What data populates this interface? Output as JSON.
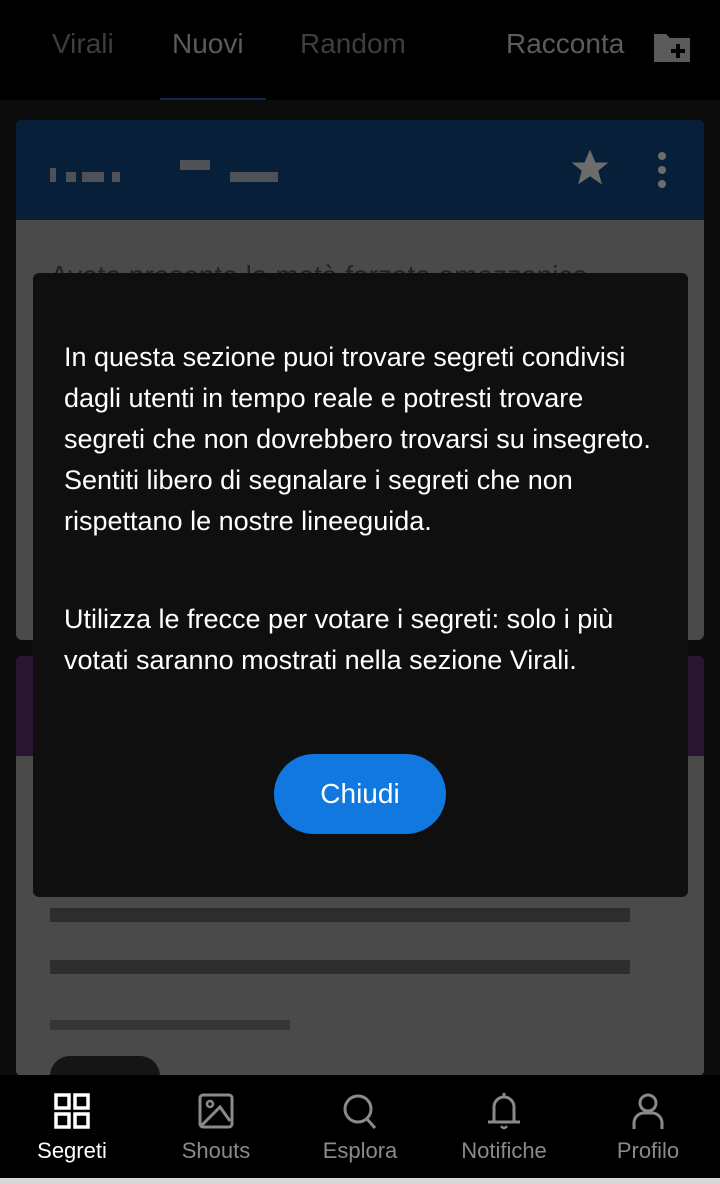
{
  "top_tabs": [
    {
      "label": "Virali",
      "active": false
    },
    {
      "label": "Nuovi",
      "active": true
    },
    {
      "label": "Random",
      "active": false
    }
  ],
  "racconta_label": "Racconta",
  "racconta_icon": "folder-plus-icon",
  "card1": {
    "header_color": "#071f38",
    "icons": [
      "star-icon",
      "more-vert-icon"
    ],
    "text_partial": "Avete presente la metà forzata amazzonica"
  },
  "card2": {
    "header_color": "#2a1530"
  },
  "modal": {
    "paragraph1": "In questa sezione puoi trovare segreti condivisi dagli utenti in tempo reale e potresti trovare segreti che non dovrebbero trovarsi su insegreto. Sentiti libero di segnalare i segreti che non rispettano le nostre lineeguida.",
    "paragraph2": "Utilizza le frecce per votare i segreti: solo i più votati saranno mostrati nella sezione Virali.",
    "close_label": "Chiudi",
    "button_color": "#1178e0"
  },
  "bottom_nav": [
    {
      "label": "Segreti",
      "icon": "grid-icon",
      "active": true
    },
    {
      "label": "Shouts",
      "icon": "image-icon",
      "active": false
    },
    {
      "label": "Esplora",
      "icon": "search-icon",
      "active": false
    },
    {
      "label": "Notifiche",
      "icon": "bell-icon",
      "active": false
    },
    {
      "label": "Profilo",
      "icon": "user-icon",
      "active": false
    }
  ]
}
